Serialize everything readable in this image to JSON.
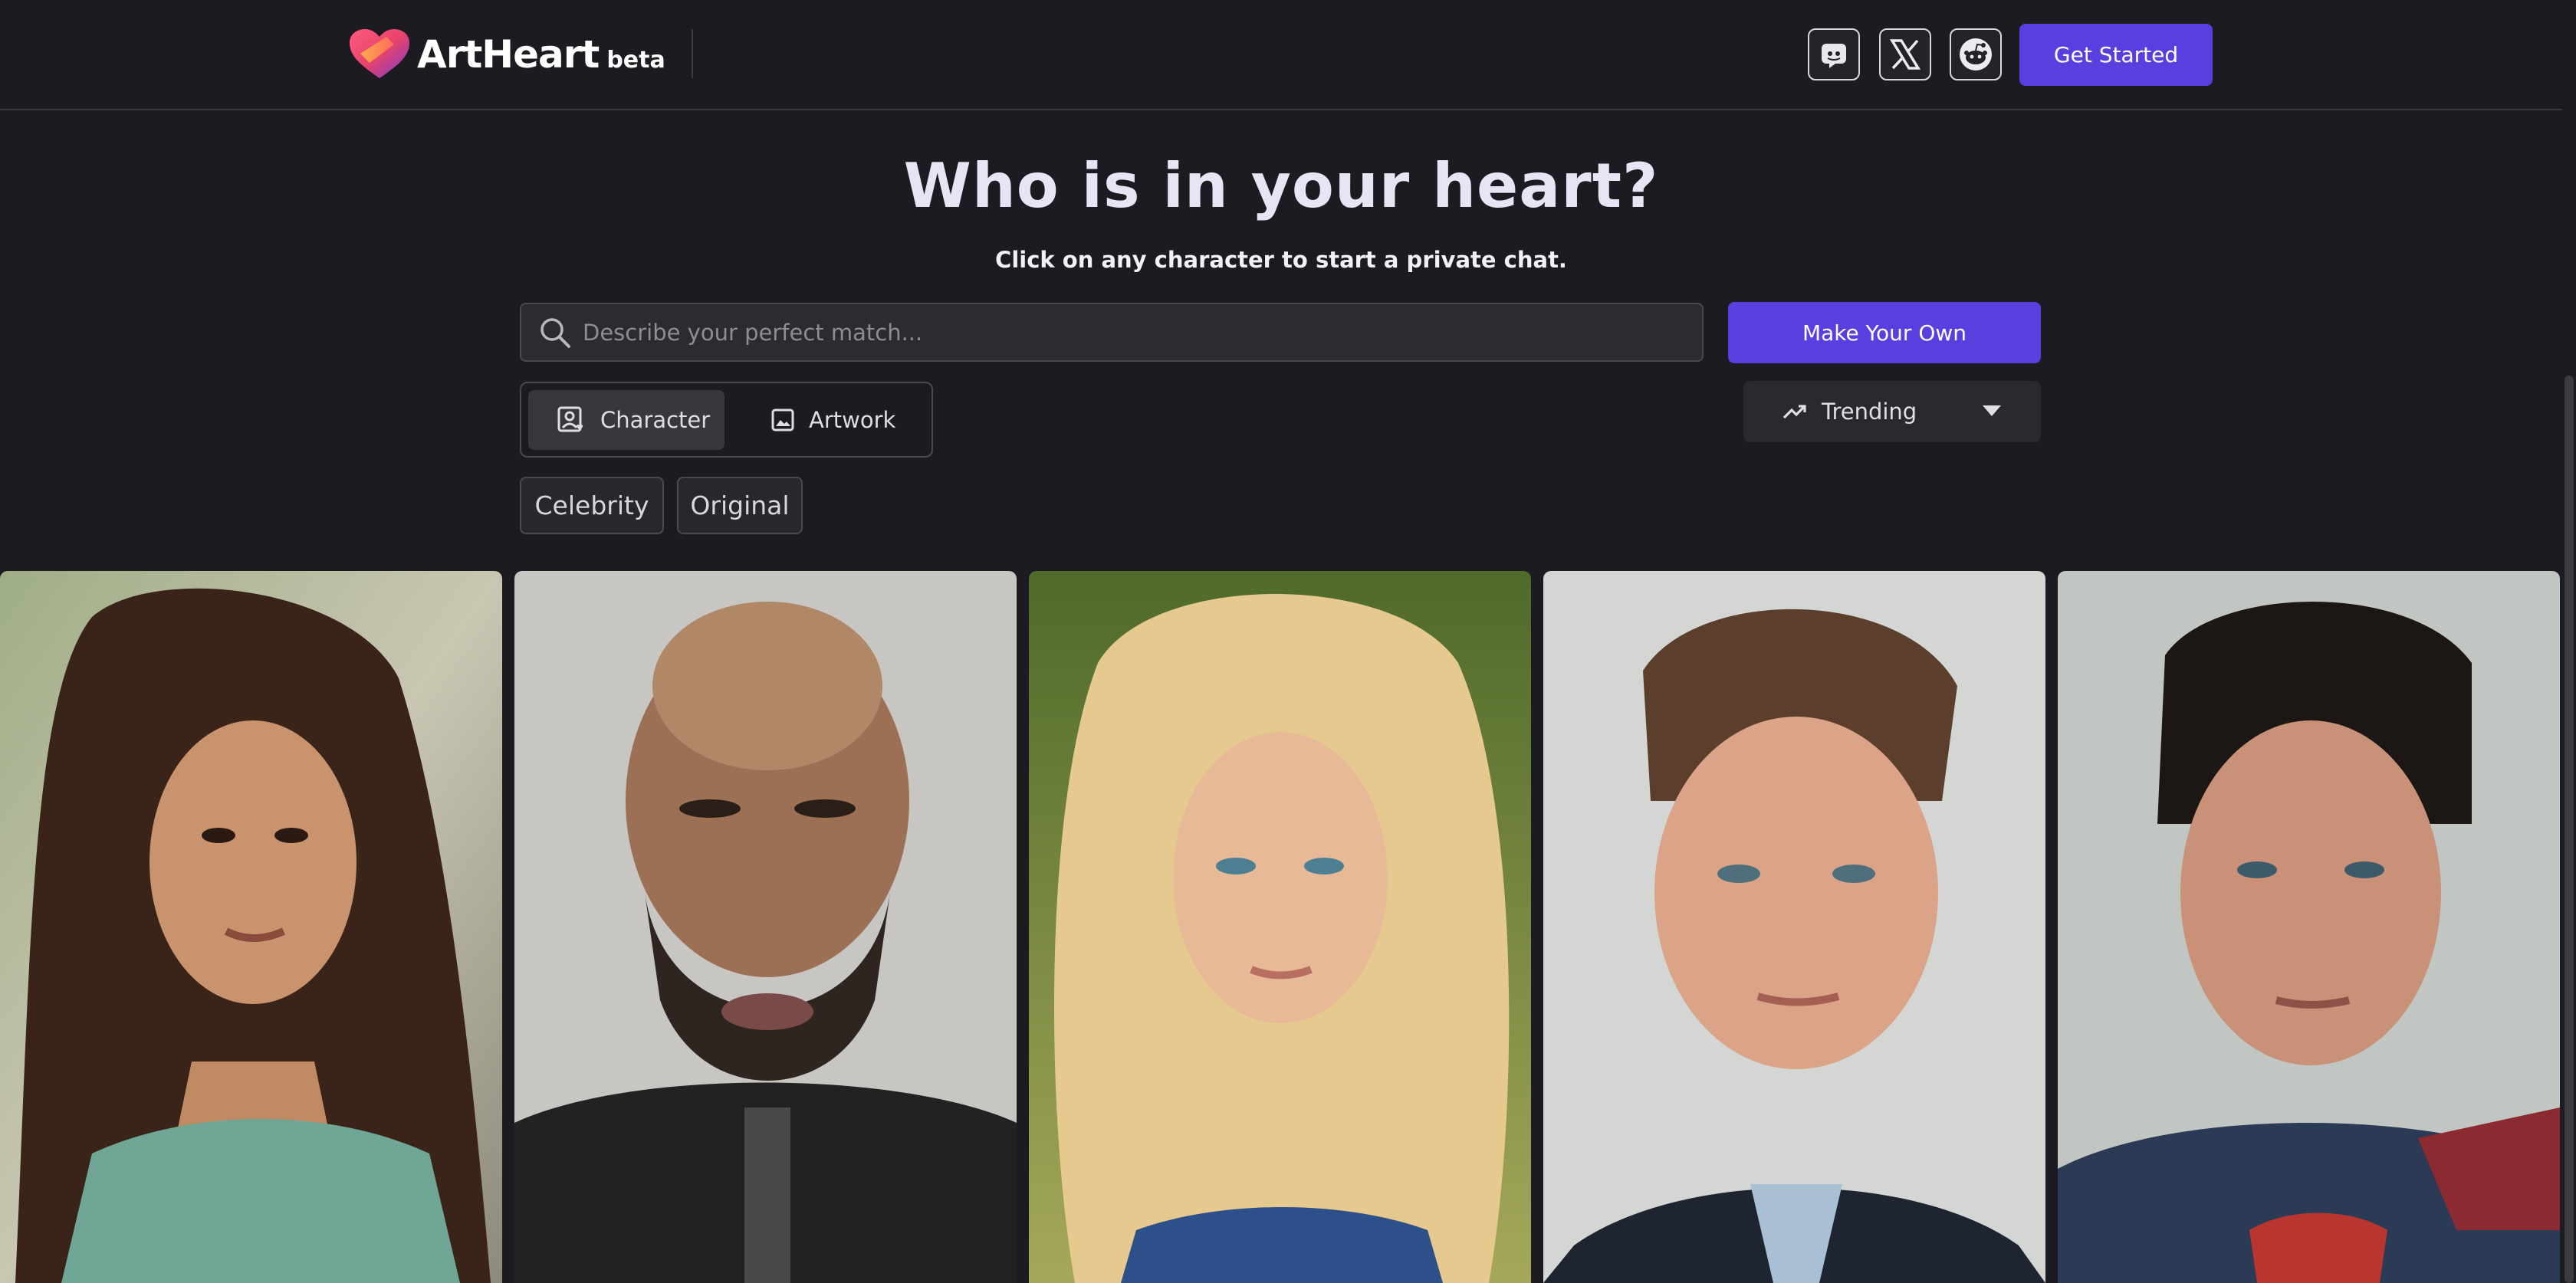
{
  "header": {
    "brand": "ArtHeart",
    "brand_badge": "beta",
    "social": [
      {
        "icon": "discord-icon"
      },
      {
        "icon": "x-icon"
      },
      {
        "icon": "reddit-icon"
      }
    ],
    "cta_label": "Get Started"
  },
  "hero": {
    "title": "Who is in your heart?",
    "subtitle": "Click on any character to start a private chat."
  },
  "search": {
    "placeholder": "Describe your perfect match...",
    "value": "",
    "make_own_label": "Make Your Own"
  },
  "type_toggle": {
    "options": [
      {
        "label": "Character",
        "icon": "character-icon",
        "active": true
      },
      {
        "label": "Artwork",
        "icon": "image-icon",
        "active": false
      }
    ]
  },
  "sort": {
    "selected": "Trending",
    "icon": "trending-up-icon"
  },
  "filters": [
    {
      "label": "Celebrity"
    },
    {
      "label": "Original"
    }
  ],
  "colors": {
    "accent": "#5a3fe0",
    "background": "#1c1b21",
    "surface": "#2c2b31"
  }
}
